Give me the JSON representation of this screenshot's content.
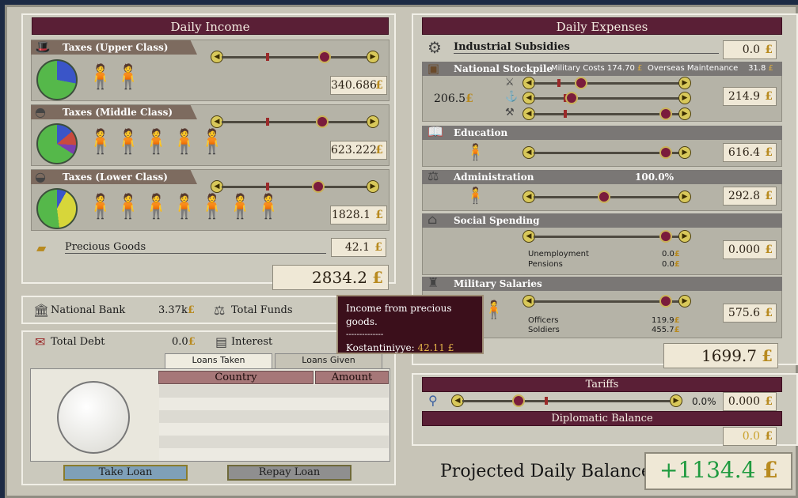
{
  "income": {
    "title": "Daily Income",
    "upper": {
      "label": "Taxes (Upper Class)",
      "value": "340.686",
      "pie": [
        "#5aa548",
        "#3b5fc8"
      ]
    },
    "middle": {
      "label": "Taxes (Middle Class)",
      "value": "623.222"
    },
    "lower": {
      "label": "Taxes (Lower Class)",
      "value": "1828.1"
    },
    "precious": {
      "label": "Precious Goods",
      "value": "42.1"
    },
    "total": "2834.2"
  },
  "bank": {
    "label": "National Bank",
    "value": "3.37k",
    "funds_label": "Total Funds"
  },
  "debt": {
    "label": "Total Debt",
    "value": "0.0",
    "interest_label": "Interest"
  },
  "loans": {
    "tab_taken": "Loans Taken",
    "tab_given": "Loans Given",
    "col_country": "Country",
    "col_amount": "Amount",
    "take": "Take Loan",
    "repay": "Repay Loan"
  },
  "expenses": {
    "title": "Daily Expenses",
    "subsidies": {
      "label": "Industrial Subsidies",
      "value": "0.0"
    },
    "stockpile": {
      "label": "National Stockpile",
      "military_label": "Military Costs",
      "military_value": "174.70",
      "overseas_label": "Overseas Maintenance",
      "overseas_value": "31.8",
      "left_value": "206.5",
      "value": "214.9"
    },
    "education": {
      "label": "Education",
      "value": "616.4"
    },
    "administration": {
      "label": "Administration",
      "pct": "100.0%",
      "value": "292.8"
    },
    "social": {
      "label": "Social Spending",
      "value": "0.000",
      "unemployment_label": "Unemployment",
      "unemployment_value": "0.0",
      "pensions_label": "Pensions",
      "pensions_value": "0.0"
    },
    "military": {
      "label": "Military Salaries",
      "value": "575.6",
      "officers_label": "Officers",
      "officers_value": "119.9",
      "soldiers_label": "Soldiers",
      "soldiers_value": "455.7"
    },
    "total": "1699.7"
  },
  "tariffs": {
    "label": "Tariffs",
    "pct": "0.0%",
    "value": "0.000",
    "diplomatic_label": "Diplomatic Balance",
    "diplomatic_value": "0.0"
  },
  "projected": {
    "label": "Projected Daily Balance",
    "value": "+1134.4"
  },
  "currency": "£",
  "tooltip": {
    "line1": "Income from precious goods.",
    "dashes": "--------------",
    "place": "Kostantiniyye:",
    "amount": "42.11"
  },
  "sliders": {
    "upper": 0.73,
    "middle": 0.71,
    "lower": 0.68,
    "stock1": 0.3,
    "stock2": 0.23,
    "stock3": 0.95,
    "education": 0.95,
    "administration": 0.48,
    "social": 0.95,
    "military": 0.95,
    "tariffs": 0.25
  }
}
